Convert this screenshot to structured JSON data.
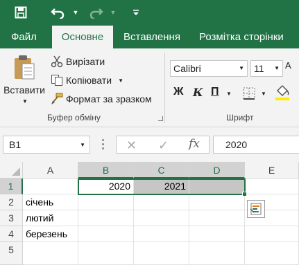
{
  "quick_access": {
    "save_icon": "save-icon",
    "undo_icon": "undo-icon",
    "redo_icon": "redo-icon",
    "customize_icon": "customize-qat-icon"
  },
  "tabs": [
    {
      "label": "Файл",
      "active": false
    },
    {
      "label": "Основне",
      "active": true
    },
    {
      "label": "Вставлення",
      "active": false
    },
    {
      "label": "Розмітка сторінки",
      "active": false
    }
  ],
  "ribbon": {
    "clipboard": {
      "paste_label": "Вставити",
      "cut_label": "Вирізати",
      "copy_label": "Копіювати",
      "format_painter_label": "Формат за зразком",
      "group_label": "Буфер обміну"
    },
    "font": {
      "font_name": "Calibri",
      "font_size": "11",
      "bold_label": "Ж",
      "italic_label": "К",
      "underline_label": "П",
      "group_label": "Шрифт"
    }
  },
  "formula_bar": {
    "name_box": "B1",
    "fx_label": "fx",
    "value": "2020"
  },
  "grid": {
    "columns": [
      "A",
      "B",
      "C",
      "D",
      "E"
    ],
    "selected_columns": [
      "B",
      "C",
      "D"
    ],
    "rows": [
      "1",
      "2",
      "3",
      "4",
      "5"
    ],
    "selected_rows": [
      "1"
    ],
    "cells": {
      "B1": "2020",
      "C1": "2021",
      "A2": "січень",
      "A3": "лютий",
      "A4": "березень"
    }
  },
  "colors": {
    "accent": "#217346",
    "selection_fill": "#c6c6c6",
    "ribbon_bg": "#f3f3f3"
  }
}
